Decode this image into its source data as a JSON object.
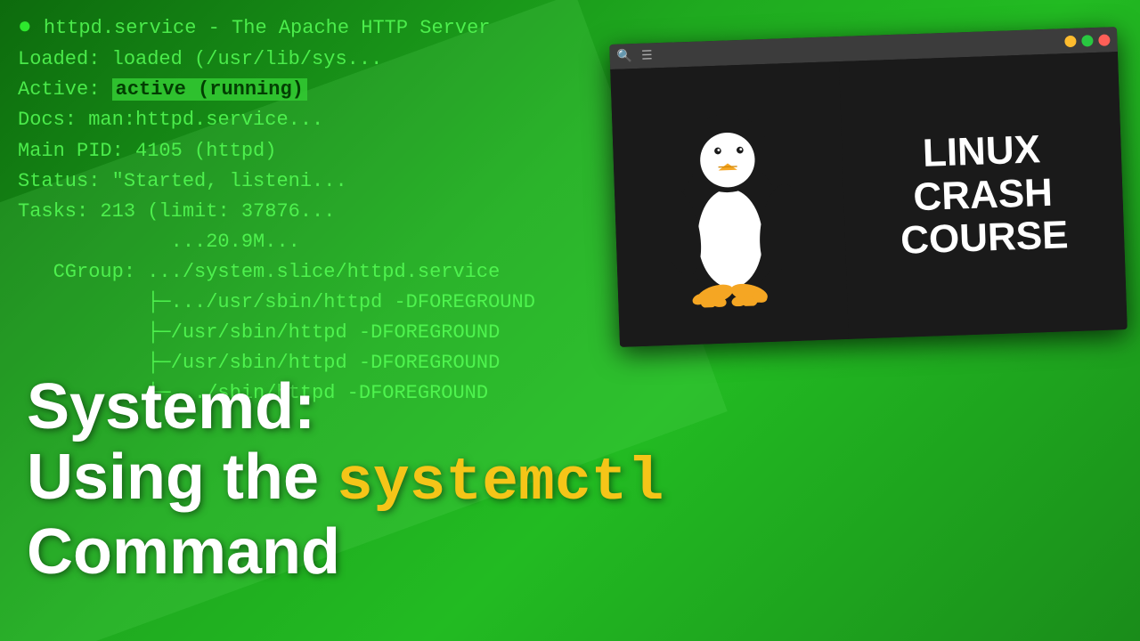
{
  "background": {
    "color_primary": "#1a8c1a",
    "color_secondary": "#0d6b0d"
  },
  "terminal": {
    "lines": [
      {
        "id": "line1",
        "text": "● httpd.service - The Apache HTTP Server",
        "style": "normal"
      },
      {
        "id": "line2_label",
        "text": "     Loaded:",
        "style": "normal"
      },
      {
        "id": "line2_value",
        "text": " loaded (/usr/lib/sys...",
        "style": "normal"
      },
      {
        "id": "line3_label",
        "text": "     Active:",
        "style": "normal"
      },
      {
        "id": "line3_value",
        "text": " active (running)",
        "style": "highlight"
      },
      {
        "id": "line4_label",
        "text": "       Docs:",
        "style": "normal"
      },
      {
        "id": "line4_value",
        "text": " man:httpd.service...",
        "style": "normal"
      },
      {
        "id": "line5_label",
        "text": "   Main PID:",
        "style": "normal"
      },
      {
        "id": "line5_value",
        "text": " 4105 (httpd)",
        "style": "normal"
      },
      {
        "id": "line6_label",
        "text": "     Status:",
        "style": "normal"
      },
      {
        "id": "line6_value",
        "text": " \"Started, listeni...",
        "style": "normal"
      },
      {
        "id": "line7_label",
        "text": "      Tasks:",
        "style": "normal"
      },
      {
        "id": "line7_value",
        "text": " 213 (limit: 37876...",
        "style": "normal"
      },
      {
        "id": "line8",
        "text": "             ...20.9M...",
        "style": "normal"
      },
      {
        "id": "line9",
        "text": "   CGroup: .../system.slice/httpd.service",
        "style": "normal"
      },
      {
        "id": "line10",
        "text": "           ├─.../usr/sbin/httpd -DFOREGROUND",
        "style": "normal"
      },
      {
        "id": "line11",
        "text": "           ├─/usr/sbin/httpd -DFOREGROUND",
        "style": "normal"
      },
      {
        "id": "line12",
        "text": "           ├─/usr/sbin/httpd -DFOREGROUND",
        "style": "normal"
      },
      {
        "id": "line13",
        "text": "           └─.../sbin/httpd -DFOREGROUND",
        "style": "normal"
      }
    ]
  },
  "overlay": {
    "line1": "Systemd:",
    "line2_prefix": "Using the ",
    "line2_highlight": "systemctl",
    "line3": "Command"
  },
  "window": {
    "title": "",
    "course_title_line1": "LINUX",
    "course_title_line2": "CRASH",
    "course_title_line3": "COURSE",
    "btn_close_label": "close",
    "btn_min_label": "minimize",
    "btn_max_label": "maximize"
  }
}
